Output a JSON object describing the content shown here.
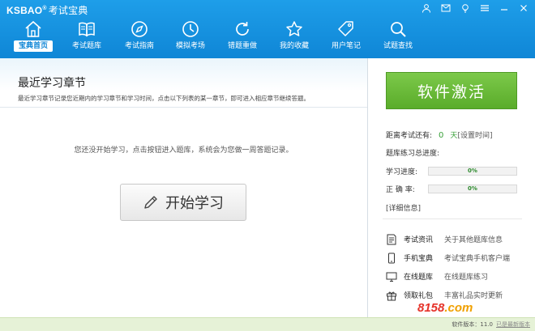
{
  "header": {
    "logo_brand": "KSBAO",
    "logo_reg": "®",
    "logo_name": "考试宝典",
    "nav": [
      {
        "label": "宝典首页",
        "icon": "home-icon",
        "active": true
      },
      {
        "label": "考试题库",
        "icon": "book-icon",
        "active": false
      },
      {
        "label": "考试指南",
        "icon": "compass-icon",
        "active": false
      },
      {
        "label": "模拟考场",
        "icon": "clock-icon",
        "active": false
      },
      {
        "label": "错题重做",
        "icon": "refresh-icon",
        "active": false
      },
      {
        "label": "我的收藏",
        "icon": "star-icon",
        "active": false
      },
      {
        "label": "用户笔记",
        "icon": "tag-icon",
        "active": false
      },
      {
        "label": "试题查找",
        "icon": "search-icon",
        "active": false
      }
    ],
    "window_controls": [
      "user-icon",
      "mail-icon",
      "bulb-icon",
      "menu-icon",
      "minimize-icon",
      "close-icon"
    ]
  },
  "left": {
    "title": "最近学习章节",
    "subtitle": "最近学习章节记录您近期内的学习章节和学习时间，点击以下列表的某一章节，即可进入相应章节继续答题。",
    "empty_message": "您还没开始学习，点击按钮进入题库，系统会为您做一周答题记录。",
    "start_button": "开始学习"
  },
  "right": {
    "activate_button": "软件激活",
    "exam_days_label": "距离考试还有:",
    "exam_days_value": "0",
    "exam_days_unit": "天",
    "set_time_link": "[设置时间]",
    "overall_label": "题库练习总进度:",
    "progress": [
      {
        "label": "学习进度:",
        "value": "0%",
        "fraction": 0
      },
      {
        "label": "正 确 率:",
        "value": "0%",
        "fraction": 0
      }
    ],
    "detail_link": "[详细信息]",
    "links": [
      {
        "name": "考试资讯",
        "desc": "关于其他题库信息",
        "icon": "info-icon"
      },
      {
        "name": "手机宝典",
        "desc": "考试宝典手机客户端",
        "icon": "phone-icon"
      },
      {
        "name": "在线题库",
        "desc": "在线题库练习",
        "icon": "monitor-icon"
      },
      {
        "name": "领取礼包",
        "desc": "丰富礼品实时更新",
        "icon": "gift-icon"
      }
    ]
  },
  "footer": {
    "version_label": "软件版本：",
    "version": "11.0",
    "update_link": "已是最新版本",
    "watermark_a": "8158",
    "watermark_b": ".com"
  },
  "colors": {
    "header_blue": "#1592df",
    "activate_green": "#6bbb38",
    "accent_green": "#38a038"
  }
}
